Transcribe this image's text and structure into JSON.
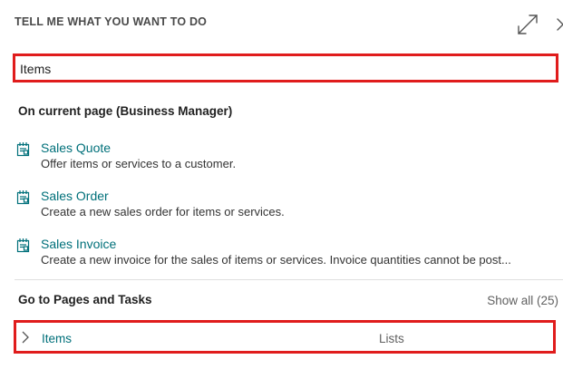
{
  "panel": {
    "title": "TELL ME WHAT YOU WANT TO DO"
  },
  "search": {
    "value": "Items",
    "placeholder": ""
  },
  "current_page": {
    "heading": "On current page (Business Manager)",
    "results": [
      {
        "name": "Sales Quote",
        "description": "Offer items or services to a customer."
      },
      {
        "name": "Sales Order",
        "description": "Create a new sales order for items or services."
      },
      {
        "name": "Sales Invoice",
        "description": "Create a new invoice for the sales of items or services. Invoice quantities cannot be post..."
      }
    ]
  },
  "pages_tasks": {
    "heading": "Go to Pages and Tasks",
    "show_all": "Show all (25)",
    "rows": [
      {
        "name": "Items",
        "type": "Lists"
      }
    ]
  },
  "colors": {
    "accent": "#00707a",
    "highlight": "#e01c1c"
  },
  "icons": {
    "expand": "expand-icon",
    "close": "close-icon",
    "document": "document-icon",
    "chevron": "chevron-right-icon"
  }
}
